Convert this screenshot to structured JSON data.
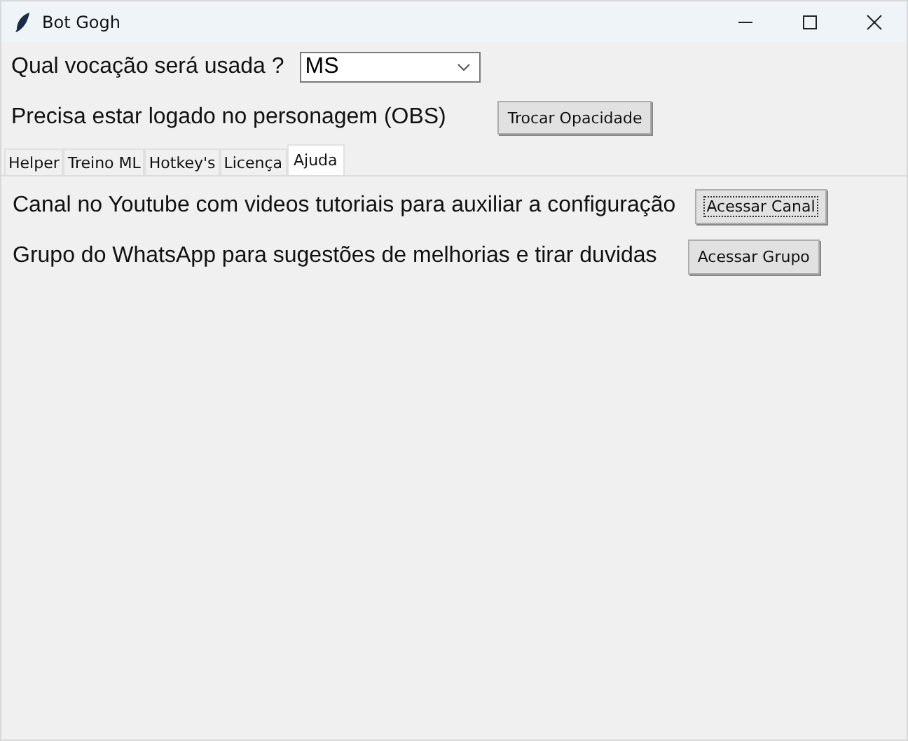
{
  "window": {
    "title": "Bot Gogh"
  },
  "vocation": {
    "label": "Qual vocação será usada ?",
    "value": "MS"
  },
  "opacity": {
    "label": "Precisa estar logado no personagem (OBS)",
    "button": "Trocar Opacidade"
  },
  "tabs": [
    {
      "label": "Helper",
      "selected": false
    },
    {
      "label": "Treino ML",
      "selected": false
    },
    {
      "label": "Hotkey's",
      "selected": false
    },
    {
      "label": "Licença",
      "selected": false
    },
    {
      "label": "Ajuda",
      "selected": true
    }
  ],
  "help_rows": [
    {
      "text": "Canal no Youtube com videos tutoriais para auxiliar a configuração",
      "button": "Acessar Canal",
      "focused": true
    },
    {
      "text": "Grupo do WhatsApp para sugestões de melhorias e tirar duvidas",
      "button": "Acessar Grupo",
      "focused": false
    }
  ]
}
